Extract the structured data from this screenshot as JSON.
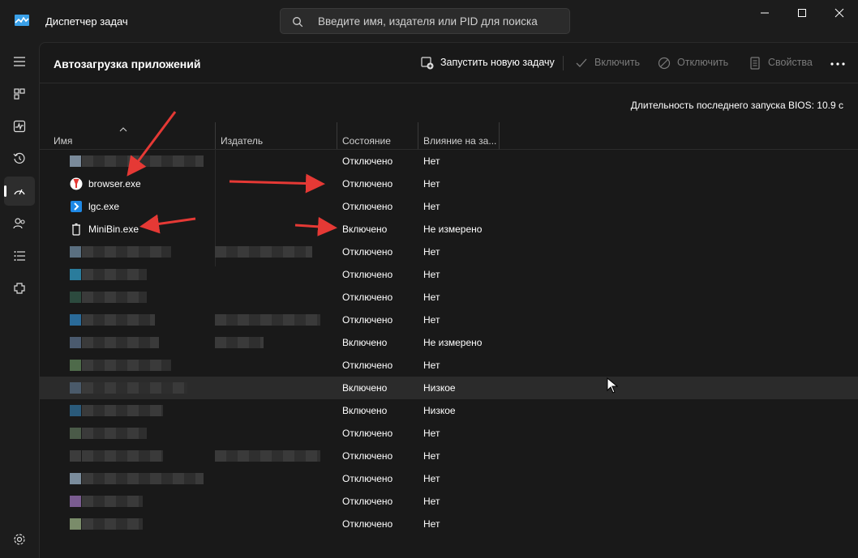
{
  "app": {
    "title": "Диспетчер задач",
    "search_placeholder": "Введите имя, издателя или PID для поиска"
  },
  "nav": {
    "items": [
      "menu-icon",
      "processes-icon",
      "performance-icon",
      "history-icon",
      "startup-icon",
      "users-icon",
      "details-icon",
      "services-icon"
    ],
    "settings": "settings-icon",
    "active": "startup-icon"
  },
  "header": {
    "title": "Автозагрузка приложений",
    "run_task": "Запустить новую задачу",
    "enable": "Включить",
    "disable": "Отключить",
    "properties": "Свойства"
  },
  "bios": "Длительность последнего запуска BIOS: 10.9 с",
  "columns": {
    "name": "Имя",
    "publisher": "Издатель",
    "state": "Состояние",
    "impact": "Влияние на за..."
  },
  "rows": [
    {
      "name": "",
      "state": "Отключено",
      "impact": "Нет"
    },
    {
      "name": "browser.exe",
      "state": "Отключено",
      "impact": "Нет"
    },
    {
      "name": "lgc.exe",
      "state": "Отключено",
      "impact": "Нет"
    },
    {
      "name": "MiniBin.exe",
      "state": "Включено",
      "impact": "Не измерено"
    },
    {
      "name": "",
      "state": "Отключено",
      "impact": "Нет"
    },
    {
      "name": "",
      "state": "Отключено",
      "impact": "Нет"
    },
    {
      "name": "",
      "state": "Отключено",
      "impact": "Нет"
    },
    {
      "name": "",
      "state": "Отключено",
      "impact": "Нет"
    },
    {
      "name": "",
      "state": "Включено",
      "impact": "Не измерено"
    },
    {
      "name": "",
      "state": "Отключено",
      "impact": "Нет"
    },
    {
      "name": "",
      "state": "Включено",
      "impact": "Низкое"
    },
    {
      "name": "",
      "state": "Включено",
      "impact": "Низкое"
    },
    {
      "name": "",
      "state": "Отключено",
      "impact": "Нет"
    },
    {
      "name": "",
      "state": "Отключено",
      "impact": "Нет"
    },
    {
      "name": "",
      "state": "Отключено",
      "impact": "Нет"
    },
    {
      "name": "",
      "state": "Отключено",
      "impact": "Нет"
    },
    {
      "name": "",
      "state": "Отключено",
      "impact": "Нет"
    }
  ],
  "colors": {
    "accent": "#60cdff",
    "annotation_arrow": "#e53935",
    "highlight_row": "#2b2b2b"
  }
}
